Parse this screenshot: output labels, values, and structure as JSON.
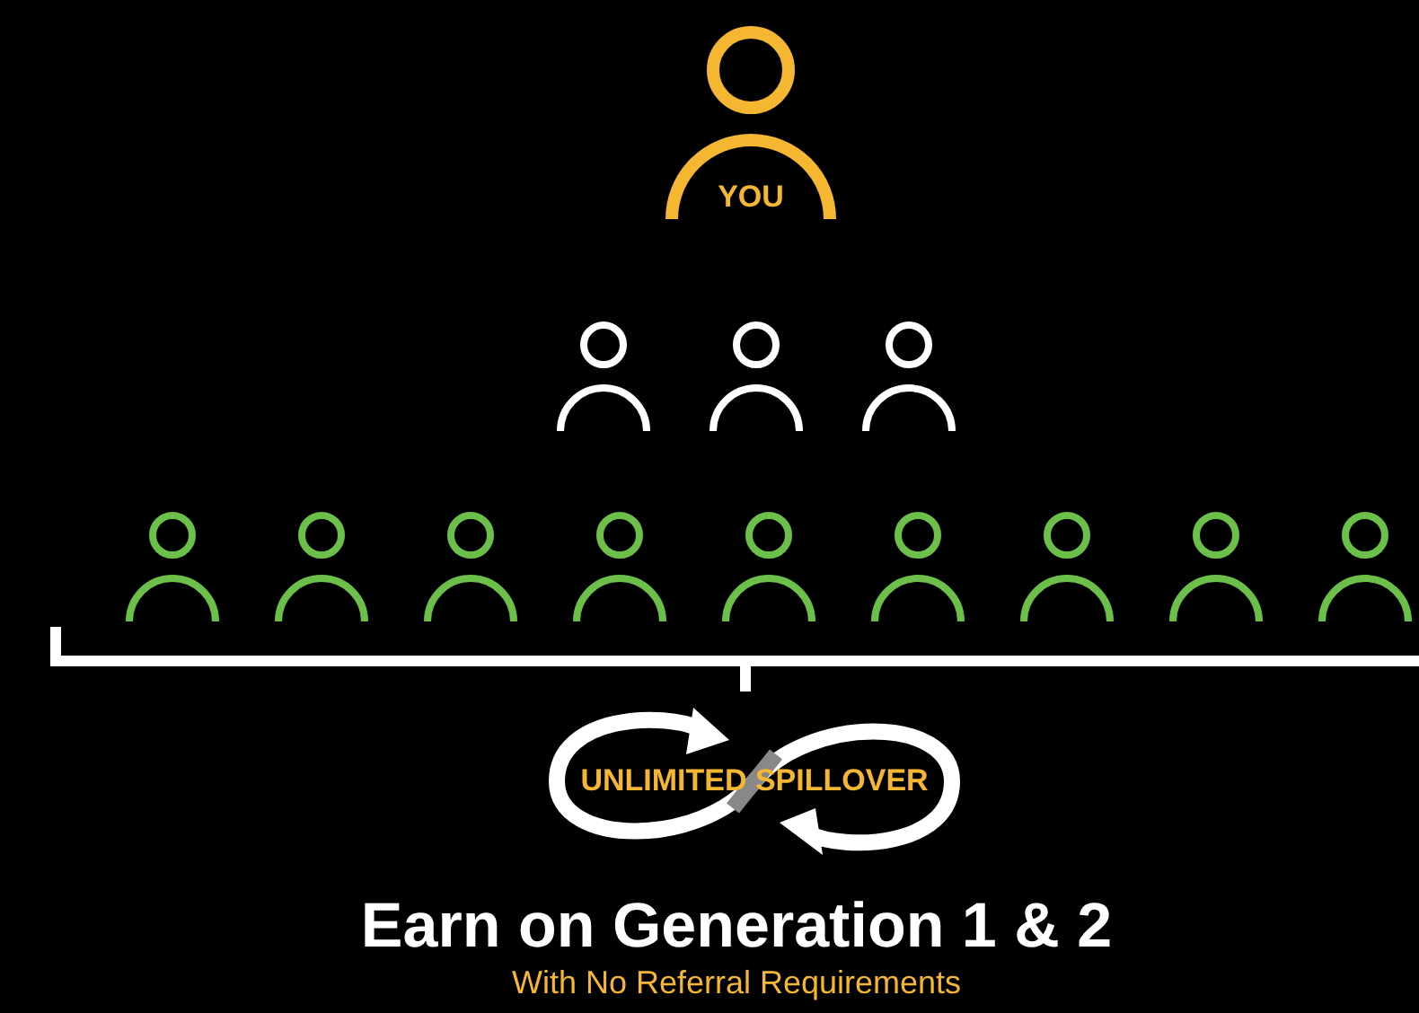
{
  "top": {
    "label": "YOU"
  },
  "generations": [
    {
      "members": [
        {
          "color": "#ffffff"
        },
        {
          "color": "#ffffff"
        },
        {
          "color": "#ffffff"
        }
      ]
    },
    {
      "members": [
        {
          "color": "#6cc04a"
        },
        {
          "color": "#6cc04a"
        },
        {
          "color": "#6cc04a"
        },
        {
          "color": "#6cc04a"
        },
        {
          "color": "#6cc04a"
        },
        {
          "color": "#6cc04a"
        },
        {
          "color": "#6cc04a"
        },
        {
          "color": "#6cc04a"
        },
        {
          "color": "#6cc04a"
        }
      ]
    }
  ],
  "badge": {
    "label": "UNLIMITED SPILLOVER"
  },
  "title": "Earn on Generation 1 & 2",
  "subtitle": "With No Referral Requirements"
}
